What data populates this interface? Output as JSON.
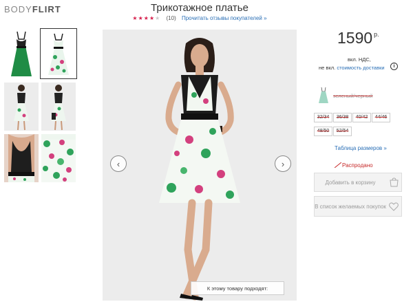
{
  "brand": {
    "prefix": "BODY",
    "suffix": "FLIRT"
  },
  "product": {
    "title": "Трикотажное платье",
    "rating": {
      "stars": 4,
      "max": 5,
      "count": "(10)"
    },
    "reviews_link": "Прочитать отзывы покупателей »"
  },
  "gallery": {
    "thumbnails": [
      {
        "name": "dress-green"
      },
      {
        "name": "dress-floral-front",
        "selected": true
      },
      {
        "name": "dress-floral-model-1"
      },
      {
        "name": "dress-floral-model-2"
      },
      {
        "name": "dress-floral-detail"
      },
      {
        "name": "dress-floral-fabric"
      }
    ],
    "prev_icon": "chevron-left-icon",
    "next_icon": "chevron-right-icon",
    "caption": "К этому товару подходят:"
  },
  "price": {
    "amount": "1590",
    "currency": "р.",
    "vat": "вкл. НДС,",
    "delivery_prefix": "не вкл.",
    "delivery_link": "стоимость доставки",
    "info_icon": "i"
  },
  "color": {
    "name": "зеленый/черный",
    "swatch": "#9fd6c3"
  },
  "sizes": [
    "32/34",
    "36/38",
    "40/42",
    "44/46",
    "48/50",
    "52/54"
  ],
  "size_table_link": "Таблица размеров »",
  "availability": "Распродано",
  "actions": {
    "add_to_cart": "Добавить в корзину",
    "wishlist": "В список желаемых покупок"
  },
  "colors": {
    "accent": "#d61f4c",
    "link": "#2a6fb6",
    "soldout": "#c62828"
  }
}
